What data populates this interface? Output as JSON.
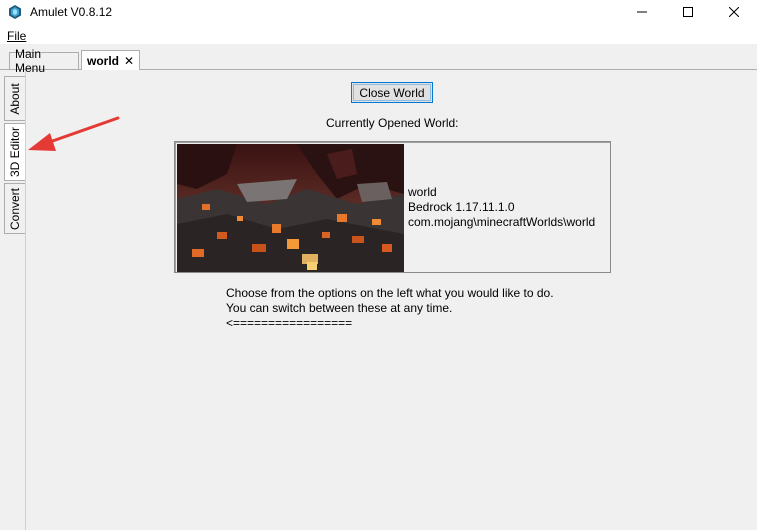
{
  "window": {
    "title": "Amulet V0.8.12",
    "controls": [
      "minimize-icon",
      "maximize-icon",
      "close-icon"
    ]
  },
  "menubar": {
    "file": "File"
  },
  "top_tabs": [
    {
      "label": "Main Menu",
      "selected": false
    },
    {
      "label": "world",
      "selected": true,
      "close": "✕"
    }
  ],
  "side_tabs": [
    {
      "label": "About",
      "selected": false
    },
    {
      "label": "3D Editor",
      "selected": true
    },
    {
      "label": "Convert",
      "selected": false
    }
  ],
  "main": {
    "close_world_label": "Close World",
    "opened_world_label": "Currently Opened World:",
    "world": {
      "name": "world",
      "version": "Bedrock 1.17.11.1.0",
      "path": "com.mojang\\minecraftWorlds\\world"
    },
    "instructions": [
      "Choose from the options on the left what you would like to do.",
      "You can switch between these at any time.",
      "<================="
    ]
  },
  "colors": {
    "arrow": "#e53935",
    "focus": "#0078d7"
  }
}
